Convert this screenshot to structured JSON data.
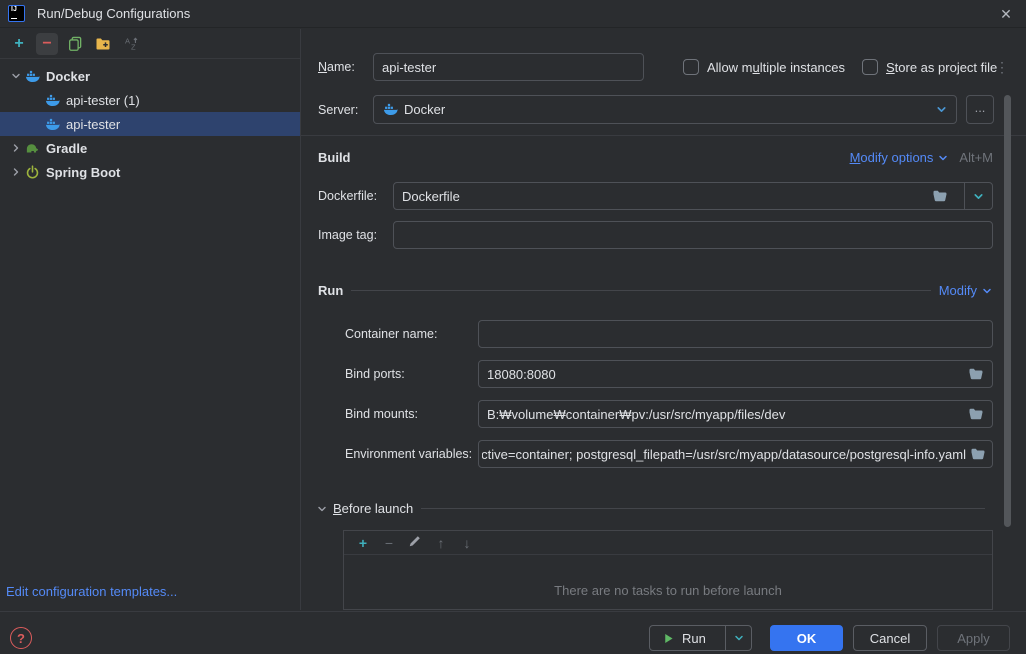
{
  "colors": {
    "background": "#2b2d30",
    "accent_blue": "#3574f0",
    "link_blue": "#548af7",
    "teal": "#3fb1be",
    "selection_blue": "#2e436e",
    "error_red": "#db5c5c",
    "docker_blue": "#3d9be9",
    "gradle_green": "#568f3f",
    "spring_green": "#9db43d"
  },
  "titlebar": {
    "title": "Run/Debug Configurations",
    "close_icon": "✕"
  },
  "sidebar": {
    "toolbar": {
      "add_icon": "+",
      "remove_icon": "−"
    },
    "tree": {
      "docker": "Docker",
      "api_tester_1": "api-tester (1)",
      "api_tester": "api-tester",
      "gradle": "Gradle",
      "spring_boot": "Spring Boot"
    },
    "edit_templates_link": "Edit configuration templates..."
  },
  "form": {
    "name": {
      "label_key": "N",
      "label_rest": "ame:",
      "value": "api-tester"
    },
    "allow_multiple": {
      "pre": "Allow m",
      "key": "u",
      "rest": "ltiple instances"
    },
    "store_as": {
      "key": "S",
      "rest": "tore as project file"
    },
    "kebab_icon": "⋮",
    "server": {
      "label": "Server:",
      "value": "Docker",
      "browse_label": "..."
    },
    "build": {
      "header": "Build",
      "modify_key": "M",
      "modify_rest": "odify options",
      "shortcut": "Alt+M"
    },
    "dockerfile": {
      "label": "Dockerfile:",
      "value": "Dockerfile"
    },
    "image_tag": {
      "label": "Image tag:",
      "value": ""
    },
    "run": {
      "header": "Run",
      "modify": "Modify"
    },
    "container_name": {
      "label": "Container name:",
      "value": ""
    },
    "bind_ports": {
      "label": "Bind ports:",
      "value": "18080:8080"
    },
    "bind_mounts": {
      "label": "Bind mounts:",
      "value": "B:₩volume₩container₩pv:/usr/src/myapp/files/dev"
    },
    "env_vars": {
      "label": "Environment variables:",
      "value": "es_active=container; postgresql_filepath=/usr/src/myapp/datasource/postgresql-info.yaml"
    },
    "before_launch": {
      "key": "B",
      "rest": "efore launch",
      "add_icon": "+",
      "remove_icon": "−",
      "up_icon": "↑",
      "down_icon": "↓",
      "empty_text": "There are no tasks to run before launch"
    }
  },
  "footer": {
    "help_icon": "?",
    "run_label": "Run",
    "ok_label": "OK",
    "cancel_label": "Cancel",
    "apply_label": "Apply"
  }
}
